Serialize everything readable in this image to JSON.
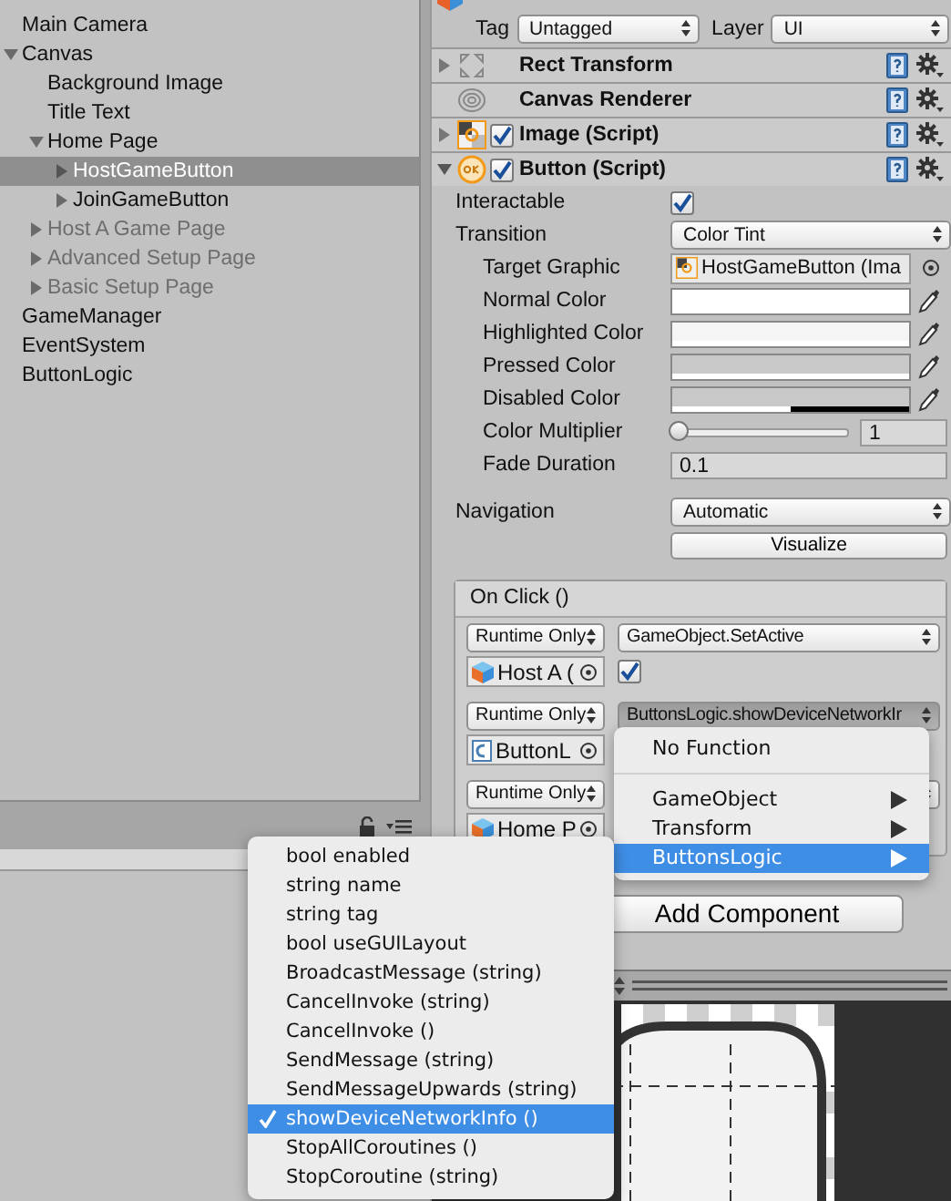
{
  "hierarchy": {
    "items": [
      {
        "label": "Main Camera",
        "kind": "leaf",
        "selected": false,
        "inactive": false
      },
      {
        "label": "Canvas",
        "kind": "group",
        "expanded": true,
        "selected": false,
        "inactive": false,
        "children": [
          {
            "label": "Background Image",
            "kind": "leaf",
            "selected": false,
            "inactive": false
          },
          {
            "label": "Title Text",
            "kind": "leaf",
            "selected": false,
            "inactive": false
          },
          {
            "label": "Home Page",
            "kind": "group",
            "expanded": true,
            "selected": false,
            "inactive": false,
            "children": [
              {
                "label": "HostGameButton",
                "kind": "group",
                "expanded": false,
                "selected": true,
                "inactive": false
              },
              {
                "label": "JoinGameButton",
                "kind": "group",
                "expanded": false,
                "selected": false,
                "inactive": false
              }
            ]
          },
          {
            "label": "Host A Game Page",
            "kind": "group",
            "expanded": false,
            "selected": false,
            "inactive": true
          },
          {
            "label": "Advanced Setup Page",
            "kind": "group",
            "expanded": false,
            "selected": false,
            "inactive": true
          },
          {
            "label": "Basic Setup Page",
            "kind": "group",
            "expanded": false,
            "selected": false,
            "inactive": true
          }
        ]
      },
      {
        "label": "GameManager",
        "kind": "leaf",
        "selected": false,
        "inactive": false
      },
      {
        "label": "EventSystem",
        "kind": "leaf",
        "selected": false,
        "inactive": false
      },
      {
        "label": "ButtonLogic",
        "kind": "leaf",
        "selected": false,
        "inactive": false
      }
    ]
  },
  "inspector": {
    "tag": {
      "label": "Tag",
      "value": "Untagged"
    },
    "layer": {
      "label": "Layer",
      "value": "UI"
    },
    "components": [
      {
        "name": "Rect Transform",
        "kind": "rect-transform",
        "expanded": false
      },
      {
        "name": "Canvas Renderer",
        "kind": "canvas-renderer"
      },
      {
        "name": "Image (Script)",
        "kind": "image",
        "expanded": false,
        "enabled": true
      },
      {
        "name": "Button (Script)",
        "kind": "button",
        "expanded": true,
        "enabled": true
      }
    ],
    "properties": [
      {
        "kind": "toggle",
        "label": "Interactable",
        "checked": true
      },
      {
        "kind": "dropdown",
        "label": "Transition",
        "value": "Color Tint",
        "children": [
          {
            "kind": "object",
            "label": "Target Graphic",
            "value": "HostGameButton (Ima"
          },
          {
            "kind": "color",
            "label": "Normal Color",
            "color": "#ffffff",
            "level": 1
          },
          {
            "kind": "color",
            "label": "Highlighted Color",
            "color": "#f5f5f5",
            "level": 1
          },
          {
            "kind": "color",
            "label": "Pressed Color",
            "color": "#c8c8c8",
            "level": 1
          },
          {
            "kind": "color",
            "label": "Disabled Color",
            "color": "#c8c8c8",
            "level": 0.5
          },
          {
            "kind": "slider",
            "label": "Color Multiplier",
            "level": 0,
            "value": "1"
          },
          {
            "kind": "number",
            "label": "Fade Duration",
            "value": "0.1"
          }
        ]
      }
    ],
    "navigation": {
      "label": "Navigation",
      "value": "Automatic",
      "button": "Visualize"
    },
    "on_click": {
      "title": "On Click ()",
      "entries": [
        {
          "mode": "Runtime Only",
          "function": "GameObject.SetActive",
          "pressed": false,
          "target": "Host A (",
          "kind": "prefab",
          "checked": true
        },
        {
          "mode": "Runtime Only",
          "function": "ButtonsLogic.showDeviceNetworkIr",
          "pressed": true,
          "target": "ButtonL",
          "kind": "script"
        },
        {
          "mode": "Runtime Only",
          "pressed": false,
          "target": "Home P",
          "kind": "prefab"
        }
      ]
    },
    "add_component": "Add Component"
  },
  "function_menu": {
    "groups": [
      [
        {
          "label": "No Function",
          "submenu": false,
          "selected": false
        }
      ],
      [
        {
          "label": "GameObject",
          "submenu": true,
          "selected": false
        },
        {
          "label": "Transform",
          "submenu": true,
          "selected": false
        },
        {
          "label": "ButtonsLogic",
          "submenu": true,
          "selected": true
        }
      ]
    ]
  },
  "method_menu": {
    "items": [
      {
        "label": "bool enabled",
        "selected": false
      },
      {
        "label": "string name",
        "selected": false
      },
      {
        "label": "string tag",
        "selected": false
      },
      {
        "label": "bool useGUILayout",
        "selected": false
      },
      {
        "label": "BroadcastMessage (string)",
        "selected": false
      },
      {
        "label": "CancelInvoke (string)",
        "selected": false
      },
      {
        "label": "CancelInvoke ()",
        "selected": false
      },
      {
        "label": "SendMessage (string)",
        "selected": false
      },
      {
        "label": "SendMessageUpwards (string)",
        "selected": false
      },
      {
        "label": "showDeviceNetworkInfo ()",
        "selected": true
      },
      {
        "label": "StopAllCoroutines ()",
        "selected": false
      },
      {
        "label": "StopCoroutine (string)",
        "selected": false
      }
    ]
  }
}
